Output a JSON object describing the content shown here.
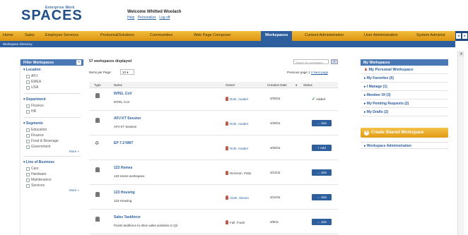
{
  "header": {
    "logo_top": "Enterprise Work",
    "logo_main": "SPACES",
    "welcome": "Welcome Whitted Woolach",
    "links": [
      "Help",
      "Personalize",
      "Log off"
    ]
  },
  "nav": {
    "items": [
      "Home",
      "Sales",
      "Employee Services",
      "Products&Solutions",
      "Communities",
      "Web Page Composer",
      "Workspaces",
      "Content Administration",
      "User Administration",
      "System Administ"
    ],
    "active": "Workspaces",
    "sub": "Workspace Directory"
  },
  "filter": {
    "title": "Filter Workspaces",
    "collapse_glyph": "«",
    "groups": [
      {
        "title": "▾ Location",
        "options": [
          "APJ",
          "EMEA",
          "USA"
        ],
        "more": ""
      },
      {
        "title": "▾ Department",
        "options": [
          "Finance",
          "HR"
        ],
        "more": ""
      },
      {
        "title": "▾ Segments",
        "options": [
          "Education",
          "Finance",
          "Food & Beverage",
          "Government"
        ],
        "more": "More »"
      },
      {
        "title": "▾ Line of Business",
        "options": [
          "Cars",
          "Hardware",
          "Maintenance",
          "Services"
        ],
        "more": "More »"
      }
    ]
  },
  "main": {
    "count": "57 workspaces displayed",
    "search_placeholder": "Search for workspace",
    "items_per_page_label": "Items per Page:",
    "items_per_page": "10 ▾",
    "pager_prefix": "Previous page",
    "pager_current": "1",
    "pager_next": "2 Next page",
    "columns": [
      "Type",
      "Name",
      "Owner",
      "Creation Date",
      "♦",
      "Status"
    ],
    "rows": [
      {
        "name": "INTEL CoV",
        "desc": "INTEL CoV",
        "owner": "Rohr, Anabel",
        "owner_link": true,
        "date": "4/28/11",
        "status": "Added",
        "type": "lock"
      },
      {
        "name": "APJ KT Session",
        "desc": "APJ KT Session",
        "owner": "Rohr, Anabel",
        "owner_link": true,
        "date": "4/28/11",
        "status": "→ Join",
        "type": "lock"
      },
      {
        "name": "EP 7.3 NW7",
        "desc": "",
        "owner": "Rohr, Anabel",
        "owner_link": true,
        "date": "3/28/11",
        "status": "+ Add",
        "type": "open"
      },
      {
        "name": "123 Homes",
        "desc": "123 Home workspace",
        "owner": "Dickman, Patty",
        "owner_link": false,
        "date": "3/14/11",
        "status": "→ Join",
        "type": "lock"
      },
      {
        "name": "123 Housing",
        "desc": "123 Housing",
        "owner": "Clark, Steven",
        "owner_link": true,
        "date": "3/12/11",
        "status": "→ Join",
        "type": "lock"
      },
      {
        "name": "Sales Taskforce",
        "desc": "Points taskforce to drive sales activities in Q2",
        "owner": "Fall, Frank",
        "owner_link": false,
        "date": "3/8/11",
        "status": "→ Join",
        "type": "lock"
      }
    ],
    "added_check": "✔"
  },
  "right": {
    "title": "My Workspaces",
    "links": [
      "My Personal Workspace",
      "▸ My Favorites (0)",
      "▸ I Manage (1)",
      "▸ Member Of (3)",
      "▸ My Pending Requests (2)",
      "▸ My Drafts (2)"
    ],
    "create": "Create Shared Workspace",
    "admin": "▸ Workspace Administration"
  },
  "icons": {
    "scroll_up": "▴",
    "search": "⌕",
    "plus": "+",
    "left_arrow": "◂",
    "right_arrow": "▸"
  }
}
